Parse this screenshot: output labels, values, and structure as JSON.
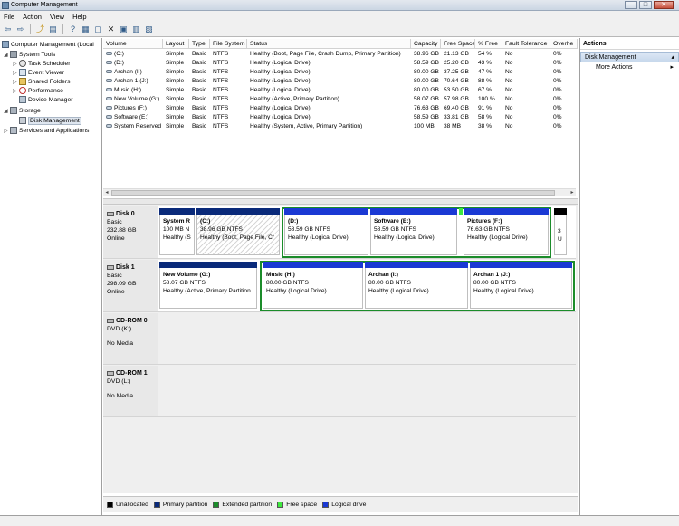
{
  "window": {
    "title": "Computer Management"
  },
  "menu": [
    "File",
    "Action",
    "View",
    "Help"
  ],
  "toolbar_icons": [
    "back-icon",
    "forward-icon",
    "up-icon",
    "show-hide-tree-icon",
    "help-icon",
    "console-help-icon",
    "properties-icon",
    "delete-icon",
    "open-icon",
    "save-icon",
    "rescan-icon"
  ],
  "tree": {
    "root": "Computer Management (Local",
    "system_tools": "System Tools",
    "task_scheduler": "Task Scheduler",
    "event_viewer": "Event Viewer",
    "shared_folders": "Shared Folders",
    "performance": "Performance",
    "device_manager": "Device Manager",
    "storage": "Storage",
    "disk_management": "Disk Management",
    "services": "Services and Applications"
  },
  "volume_list": {
    "columns": [
      "Volume",
      "Layout",
      "Type",
      "File System",
      "Status",
      "Capacity",
      "Free Space",
      "% Free",
      "Fault Tolerance",
      "Overhe"
    ],
    "rows": [
      [
        "(C:)",
        "Simple",
        "Basic",
        "NTFS",
        "Healthy (Boot, Page File, Crash Dump, Primary Partition)",
        "38.96 GB",
        "21.13 GB",
        "54 %",
        "No",
        "0%"
      ],
      [
        "(D:)",
        "Simple",
        "Basic",
        "NTFS",
        "Healthy (Logical Drive)",
        "58.59 GB",
        "25.20 GB",
        "43 %",
        "No",
        "0%"
      ],
      [
        "Archan (I:)",
        "Simple",
        "Basic",
        "NTFS",
        "Healthy (Logical Drive)",
        "80.00 GB",
        "37.25 GB",
        "47 %",
        "No",
        "0%"
      ],
      [
        "Archan 1 (J:)",
        "Simple",
        "Basic",
        "NTFS",
        "Healthy (Logical Drive)",
        "80.00 GB",
        "70.64 GB",
        "88 %",
        "No",
        "0%"
      ],
      [
        "Music (H:)",
        "Simple",
        "Basic",
        "NTFS",
        "Healthy (Logical Drive)",
        "80.00 GB",
        "53.50 GB",
        "67 %",
        "No",
        "0%"
      ],
      [
        "New Volume (G:)",
        "Simple",
        "Basic",
        "NTFS",
        "Healthy (Active, Primary Partition)",
        "58.07 GB",
        "57.98 GB",
        "100 %",
        "No",
        "0%"
      ],
      [
        "Pictures (F:)",
        "Simple",
        "Basic",
        "NTFS",
        "Healthy (Logical Drive)",
        "76.63 GB",
        "69.40 GB",
        "91 %",
        "No",
        "0%"
      ],
      [
        "Software (E:)",
        "Simple",
        "Basic",
        "NTFS",
        "Healthy (Logical Drive)",
        "58.59 GB",
        "33.81 GB",
        "58 %",
        "No",
        "0%"
      ],
      [
        "System Reserved",
        "Simple",
        "Basic",
        "NTFS",
        "Healthy (System, Active, Primary Partition)",
        "100 MB",
        "38 MB",
        "38 %",
        "No",
        "0%"
      ]
    ]
  },
  "disks": [
    {
      "name": "Disk 0",
      "type": "Basic",
      "size": "232.88 GB",
      "status": "Online",
      "partitions": [
        {
          "name": "System R",
          "size": "100 MB N",
          "status": "Healthy (S"
        },
        {
          "name": "(C:)",
          "size": "38.96 GB NTFS",
          "status": "Healthy (Boot, Page File, Cr"
        },
        {
          "name": "(D:)",
          "size": "58.59 GB NTFS",
          "status": "Healthy (Logical Drive)"
        },
        {
          "name": "Software  (E:)",
          "size": "58.59 GB NTFS",
          "status": "Healthy (Logical Drive)"
        },
        {
          "name": "Pictures  (F:)",
          "size": "76.63 GB NTFS",
          "status": "Healthy (Logical Drive)"
        },
        {
          "name": "",
          "size": "3",
          "status": "U"
        }
      ]
    },
    {
      "name": "Disk 1",
      "type": "Basic",
      "size": "298.09 GB",
      "status": "Online",
      "partitions": [
        {
          "name": "New Volume  (G:)",
          "size": "58.07 GB NTFS",
          "status": "Healthy (Active, Primary Partition"
        },
        {
          "name": "Music  (H:)",
          "size": "80.00 GB NTFS",
          "status": "Healthy (Logical Drive)"
        },
        {
          "name": "Archan  (I:)",
          "size": "80.00 GB NTFS",
          "status": "Healthy (Logical Drive)"
        },
        {
          "name": "Archan 1  (J:)",
          "size": "80.00 GB NTFS",
          "status": "Healthy (Logical Drive)"
        }
      ]
    },
    {
      "name": "CD-ROM 0",
      "type": "DVD (K:)",
      "size": "",
      "status": "No Media",
      "partitions": []
    },
    {
      "name": "CD-ROM 1",
      "type": "DVD (L:)",
      "size": "",
      "status": "No Media",
      "partitions": []
    }
  ],
  "legend": [
    {
      "label": "Unallocated",
      "color": "#000000"
    },
    {
      "label": "Primary partition",
      "color": "#0a2a7a"
    },
    {
      "label": "Extended partition",
      "color": "#1b8c2a"
    },
    {
      "label": "Free space",
      "color": "#3ee83e"
    },
    {
      "label": "Logical drive",
      "color": "#1a39d4"
    }
  ],
  "actions": {
    "title": "Actions",
    "section": "Disk Management",
    "more": "More Actions"
  }
}
